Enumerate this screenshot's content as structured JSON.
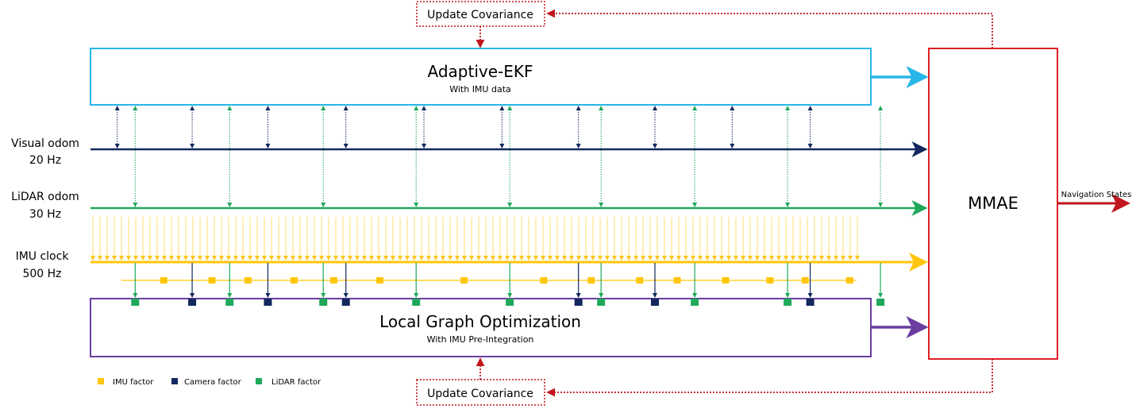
{
  "colors": {
    "ekf": "#29B6E8",
    "visual": "#12285E",
    "lidar": "#1FA85A",
    "imu": "#FFC60B",
    "lgo": "#6A3DA0",
    "mmae": "#E01F26",
    "feedback": "#C0161D"
  },
  "ekf_block": {
    "title": "Adaptive-EKF",
    "subtitle": "With IMU data"
  },
  "lgo_block": {
    "title": "Local Graph Optimization",
    "subtitle": "With IMU Pre-Integration"
  },
  "mmae_block": {
    "title": "MMAE",
    "output_label": "Navigation States"
  },
  "update_top": {
    "label": "Update Covariance"
  },
  "update_bottom": {
    "label": "Update Covariance"
  },
  "streams": [
    {
      "name": "Visual odom",
      "rate": "20 Hz"
    },
    {
      "name": "LiDAR odom",
      "rate": "30 Hz"
    },
    {
      "name": "IMU clock",
      "rate": "500 Hz"
    }
  ],
  "legend": [
    {
      "label": "IMU factor",
      "color_key": "imu"
    },
    {
      "label": "Camera factor",
      "color_key": "visual"
    },
    {
      "label": "LiDAR factor",
      "color_key": "lidar"
    }
  ],
  "events": {
    "visual_times": [
      0.017,
      0.113,
      0.21,
      0.31,
      0.41,
      0.51,
      0.608,
      0.706,
      0.805,
      0.905
    ],
    "lidar_times": [
      0.04,
      0.161,
      0.281,
      0.4,
      0.52,
      0.637,
      0.757,
      0.876,
      0.995
    ],
    "camera_factors": [
      0.113,
      0.21,
      0.31,
      0.608,
      0.706,
      0.905
    ],
    "lidar_factors": [
      0.04,
      0.161,
      0.281,
      0.4,
      0.52,
      0.637,
      0.757,
      0.876,
      0.995
    ],
    "imu_factors": [
      0.076,
      0.138,
      0.184,
      0.243,
      0.294,
      0.353,
      0.461,
      0.563,
      0.624,
      0.686,
      0.734,
      0.796,
      0.853,
      0.898,
      0.955
    ]
  }
}
